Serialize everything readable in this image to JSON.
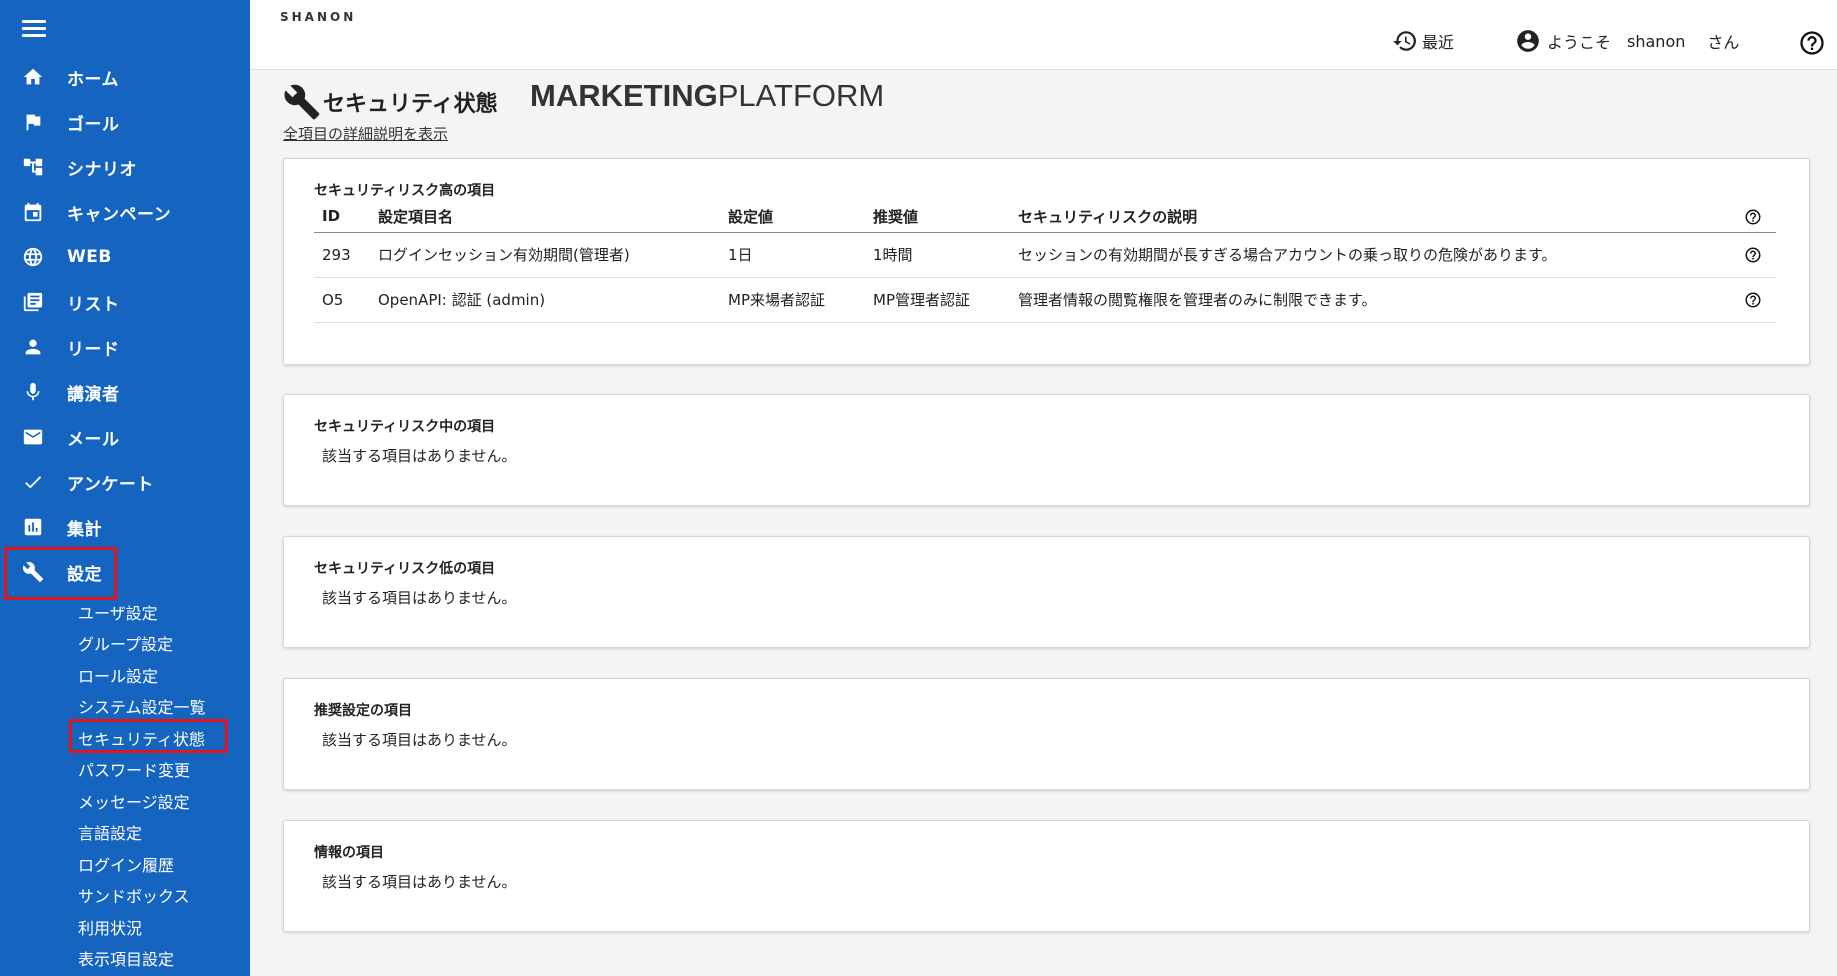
{
  "app": {
    "logo_sup": "SHANON",
    "logo_main_bold": "MARKETING",
    "logo_main_light": "PLATFORM"
  },
  "header": {
    "recent_label": "最近",
    "welcome": "ようこそ",
    "username": "shanon",
    "honorific": "さん"
  },
  "sidebar": {
    "items": [
      {
        "label": "ホーム",
        "icon": "home-icon"
      },
      {
        "label": "ゴール",
        "icon": "flag-icon"
      },
      {
        "label": "シナリオ",
        "icon": "scenario-icon"
      },
      {
        "label": "キャンペーン",
        "icon": "calendar-icon"
      },
      {
        "label": "WEB",
        "icon": "globe-icon"
      },
      {
        "label": "リスト",
        "icon": "list-icon"
      },
      {
        "label": "リード",
        "icon": "person-icon"
      },
      {
        "label": "講演者",
        "icon": "mic-icon"
      },
      {
        "label": "メール",
        "icon": "mail-icon"
      },
      {
        "label": "アンケート",
        "icon": "check-icon"
      },
      {
        "label": "集計",
        "icon": "chart-icon"
      },
      {
        "label": "設定",
        "icon": "wrench-icon"
      }
    ],
    "sub_items": [
      "ユーザ設定",
      "グループ設定",
      "ロール設定",
      "システム設定一覧",
      "セキュリティ状態",
      "パスワード変更",
      "メッセージ設定",
      "言語設定",
      "ログイン履歴",
      "サンドボックス",
      "利用状況",
      "表示項目設定"
    ],
    "highlight_color": "#e4141c",
    "bg_color": "#1565c0"
  },
  "page": {
    "title": "セキュリティ状態",
    "detail_link": "全項目の詳細説明を表示"
  },
  "high_risk": {
    "title": "セキュリティリスク高の項目",
    "columns": [
      "ID",
      "設定項目名",
      "設定値",
      "推奨値",
      "セキュリティリスクの説明"
    ],
    "rows": [
      {
        "id": "293",
        "name": "ログインセッション有効期間(管理者)",
        "value": "1日",
        "recommended": "1時間",
        "description": "セッションの有効期間が長すぎる場合アカウントの乗っ取りの危険があります。"
      },
      {
        "id": "O5",
        "name": "OpenAPI: 認証 (admin)",
        "value": "MP来場者認証",
        "recommended": "MP管理者認証",
        "description": "管理者情報の閲覧権限を管理者のみに制限できます。"
      }
    ]
  },
  "medium_risk": {
    "title": "セキュリティリスク中の項目",
    "empty": "該当する項目はありません。"
  },
  "low_risk": {
    "title": "セキュリティリスク低の項目",
    "empty": "該当する項目はありません。"
  },
  "recommended": {
    "title": "推奨設定の項目",
    "empty": "該当する項目はありません。"
  },
  "info": {
    "title": "情報の項目",
    "empty": "該当する項目はありません。"
  }
}
